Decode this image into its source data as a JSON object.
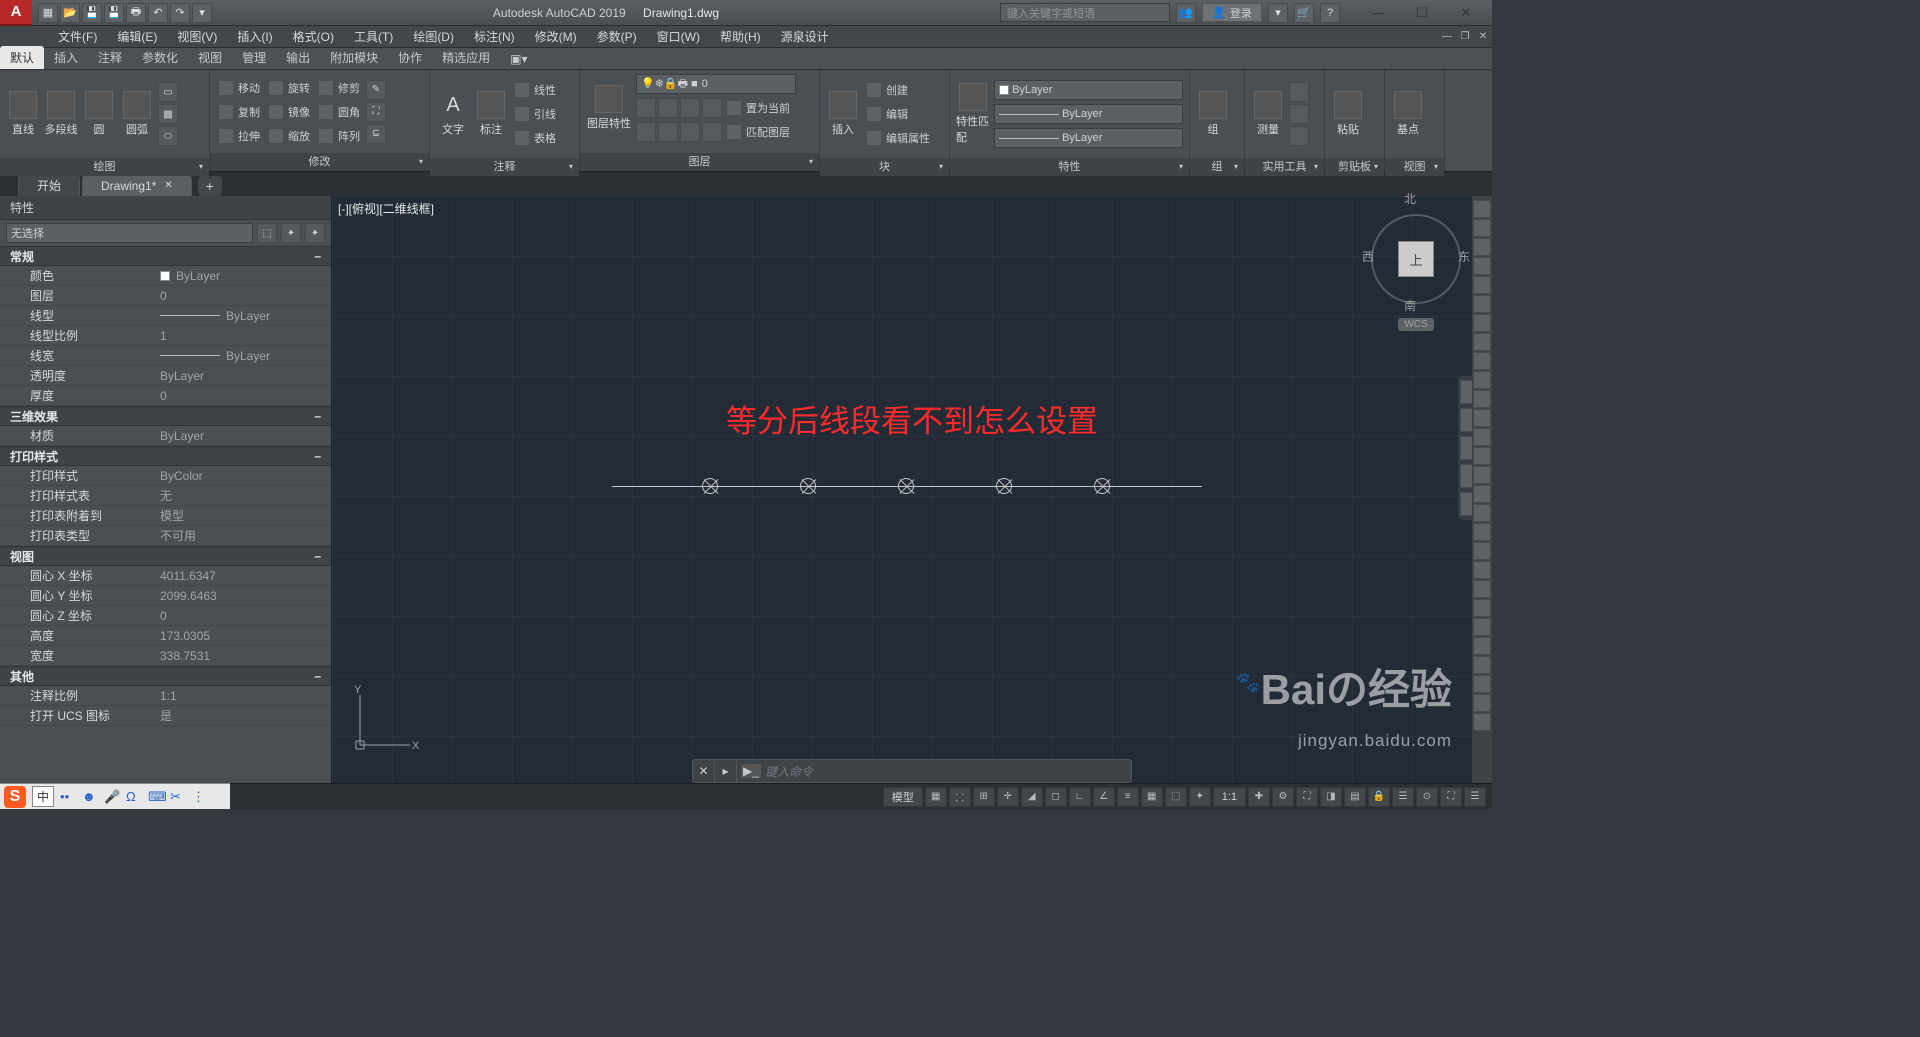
{
  "title": {
    "app": "Autodesk AutoCAD 2019",
    "doc": "Drawing1.dwg"
  },
  "search_placeholder": "键入关键字或短语",
  "login": "登录",
  "menubar": [
    "文件(F)",
    "编辑(E)",
    "视图(V)",
    "插入(I)",
    "格式(O)",
    "工具(T)",
    "绘图(D)",
    "标注(N)",
    "修改(M)",
    "参数(P)",
    "窗口(W)",
    "帮助(H)",
    "源泉设计"
  ],
  "ribbon_tabs": [
    "默认",
    "插入",
    "注释",
    "参数化",
    "视图",
    "管理",
    "输出",
    "附加模块",
    "协作",
    "精选应用"
  ],
  "panels": {
    "draw": {
      "title": "绘图",
      "items": [
        "直线",
        "多段线",
        "圆",
        "圆弧"
      ]
    },
    "modify": {
      "title": "修改",
      "rows": [
        [
          "移动",
          "旋转",
          "修剪"
        ],
        [
          "复制",
          "镜像",
          "圆角"
        ],
        [
          "拉伸",
          "缩放",
          "阵列"
        ]
      ]
    },
    "annot": {
      "title": "注释",
      "items": [
        "文字",
        "标注"
      ],
      "rows": [
        "线性",
        "引线",
        "表格"
      ]
    },
    "layer": {
      "title": "图层",
      "main": "图层特性",
      "combo": "0",
      "rows": [
        "置为当前",
        "匹配图层"
      ]
    },
    "block": {
      "title": "块",
      "main": "插入",
      "rows": [
        "创建",
        "编辑",
        "编辑属性"
      ]
    },
    "prop": {
      "title": "特性",
      "main": "特性匹配",
      "color": "ByLayer",
      "lt": "ByLayer",
      "lw": "ByLayer"
    },
    "group": {
      "title": "组",
      "main": "组"
    },
    "util": {
      "title": "实用工具",
      "main": "测量"
    },
    "clip": {
      "title": "剪贴板",
      "main": "粘贴"
    },
    "view": {
      "title": "视图",
      "main": "基点"
    }
  },
  "doctabs": {
    "start": "开始",
    "drawing": "Drawing1*"
  },
  "properties": {
    "title": "特性",
    "selector": "无选择",
    "sections": [
      {
        "name": "常规",
        "rows": [
          {
            "l": "颜色",
            "v": "ByLayer",
            "swatch": true
          },
          {
            "l": "图层",
            "v": "0"
          },
          {
            "l": "线型",
            "v": "ByLayer",
            "line": true
          },
          {
            "l": "线型比例",
            "v": "1"
          },
          {
            "l": "线宽",
            "v": "ByLayer",
            "line": true
          },
          {
            "l": "透明度",
            "v": "ByLayer"
          },
          {
            "l": "厚度",
            "v": "0"
          }
        ]
      },
      {
        "name": "三维效果",
        "rows": [
          {
            "l": "材质",
            "v": "ByLayer"
          }
        ]
      },
      {
        "name": "打印样式",
        "rows": [
          {
            "l": "打印样式",
            "v": "ByColor"
          },
          {
            "l": "打印样式表",
            "v": "无"
          },
          {
            "l": "打印表附着到",
            "v": "模型"
          },
          {
            "l": "打印表类型",
            "v": "不可用"
          }
        ]
      },
      {
        "name": "视图",
        "rows": [
          {
            "l": "圆心 X 坐标",
            "v": "4011.6347"
          },
          {
            "l": "圆心 Y 坐标",
            "v": "2099.6463"
          },
          {
            "l": "圆心 Z 坐标",
            "v": "0"
          },
          {
            "l": "高度",
            "v": "173.0305"
          },
          {
            "l": "宽度",
            "v": "338.7531"
          }
        ]
      },
      {
        "name": "其他",
        "rows": [
          {
            "l": "注释比例",
            "v": "1:1"
          },
          {
            "l": "打开 UCS 图标",
            "v": "是"
          }
        ]
      }
    ]
  },
  "canvas": {
    "viewport_label": "[-][俯视][二维线框]",
    "annotation": "等分后线段看不到怎么设置",
    "compass": {
      "n": "北",
      "s": "南",
      "e": "东",
      "w": "西",
      "top": "上",
      "wcs": "WCS"
    }
  },
  "cmd": {
    "hint": "键入命令"
  },
  "statusbar": {
    "model": "模型",
    "scale": "1:1"
  },
  "taskbar": {
    "lang": "中"
  },
  "watermark": {
    "brand": "Baiの经验",
    "url": "jingyan.baidu.com"
  }
}
